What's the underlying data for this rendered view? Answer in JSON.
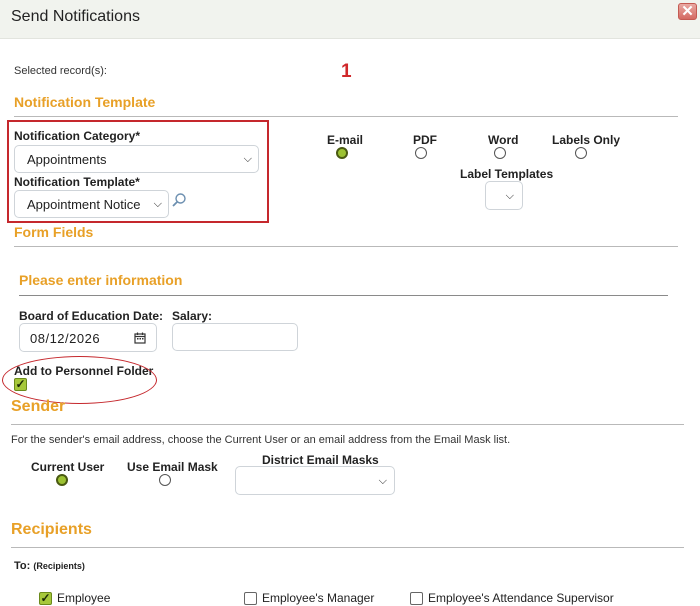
{
  "dialog": {
    "title": "Send Notifications",
    "close_label": "✕"
  },
  "selected": {
    "label": "Selected record(s):",
    "count": "1"
  },
  "template_section": {
    "heading": "Notification Template",
    "category_label": "Notification Category*",
    "category_value": "Appointments",
    "template_label": "Notification Template*",
    "template_value": "Appointment Notice",
    "delivery_options": [
      {
        "label": "E-mail",
        "selected": true
      },
      {
        "label": "PDF",
        "selected": false
      },
      {
        "label": "Word",
        "selected": false
      },
      {
        "label": "Labels Only",
        "selected": false
      }
    ],
    "label_templates_label": "Label Templates"
  },
  "form_fields": {
    "heading": "Form Fields",
    "subheading": "Please enter information",
    "board_date_label": "Board of Education Date:",
    "board_date_value": "08/12/2026",
    "salary_label": "Salary:",
    "salary_value": "",
    "personnel_folder_label": "Add to Personnel Folder",
    "personnel_folder_checked": true
  },
  "sender": {
    "heading": "Sender",
    "description": "For the sender's email address, choose the Current User or an email address from the Email Mask list.",
    "current_user_label": "Current User",
    "use_email_mask_label": "Use Email Mask",
    "district_masks_label": "District Email Masks",
    "current_user_selected": true
  },
  "recipients": {
    "heading": "Recipients",
    "to_label": "To:",
    "to_sub": "(Recipients)",
    "options": [
      {
        "label": "Employee",
        "checked": true
      },
      {
        "label": "Employee's Manager",
        "checked": false
      },
      {
        "label": "Employee's Attendance Supervisor",
        "checked": false
      }
    ]
  },
  "colors": {
    "accent": "#e8a027",
    "highlight": "#c5282d",
    "selected_green": "#9cc232"
  }
}
